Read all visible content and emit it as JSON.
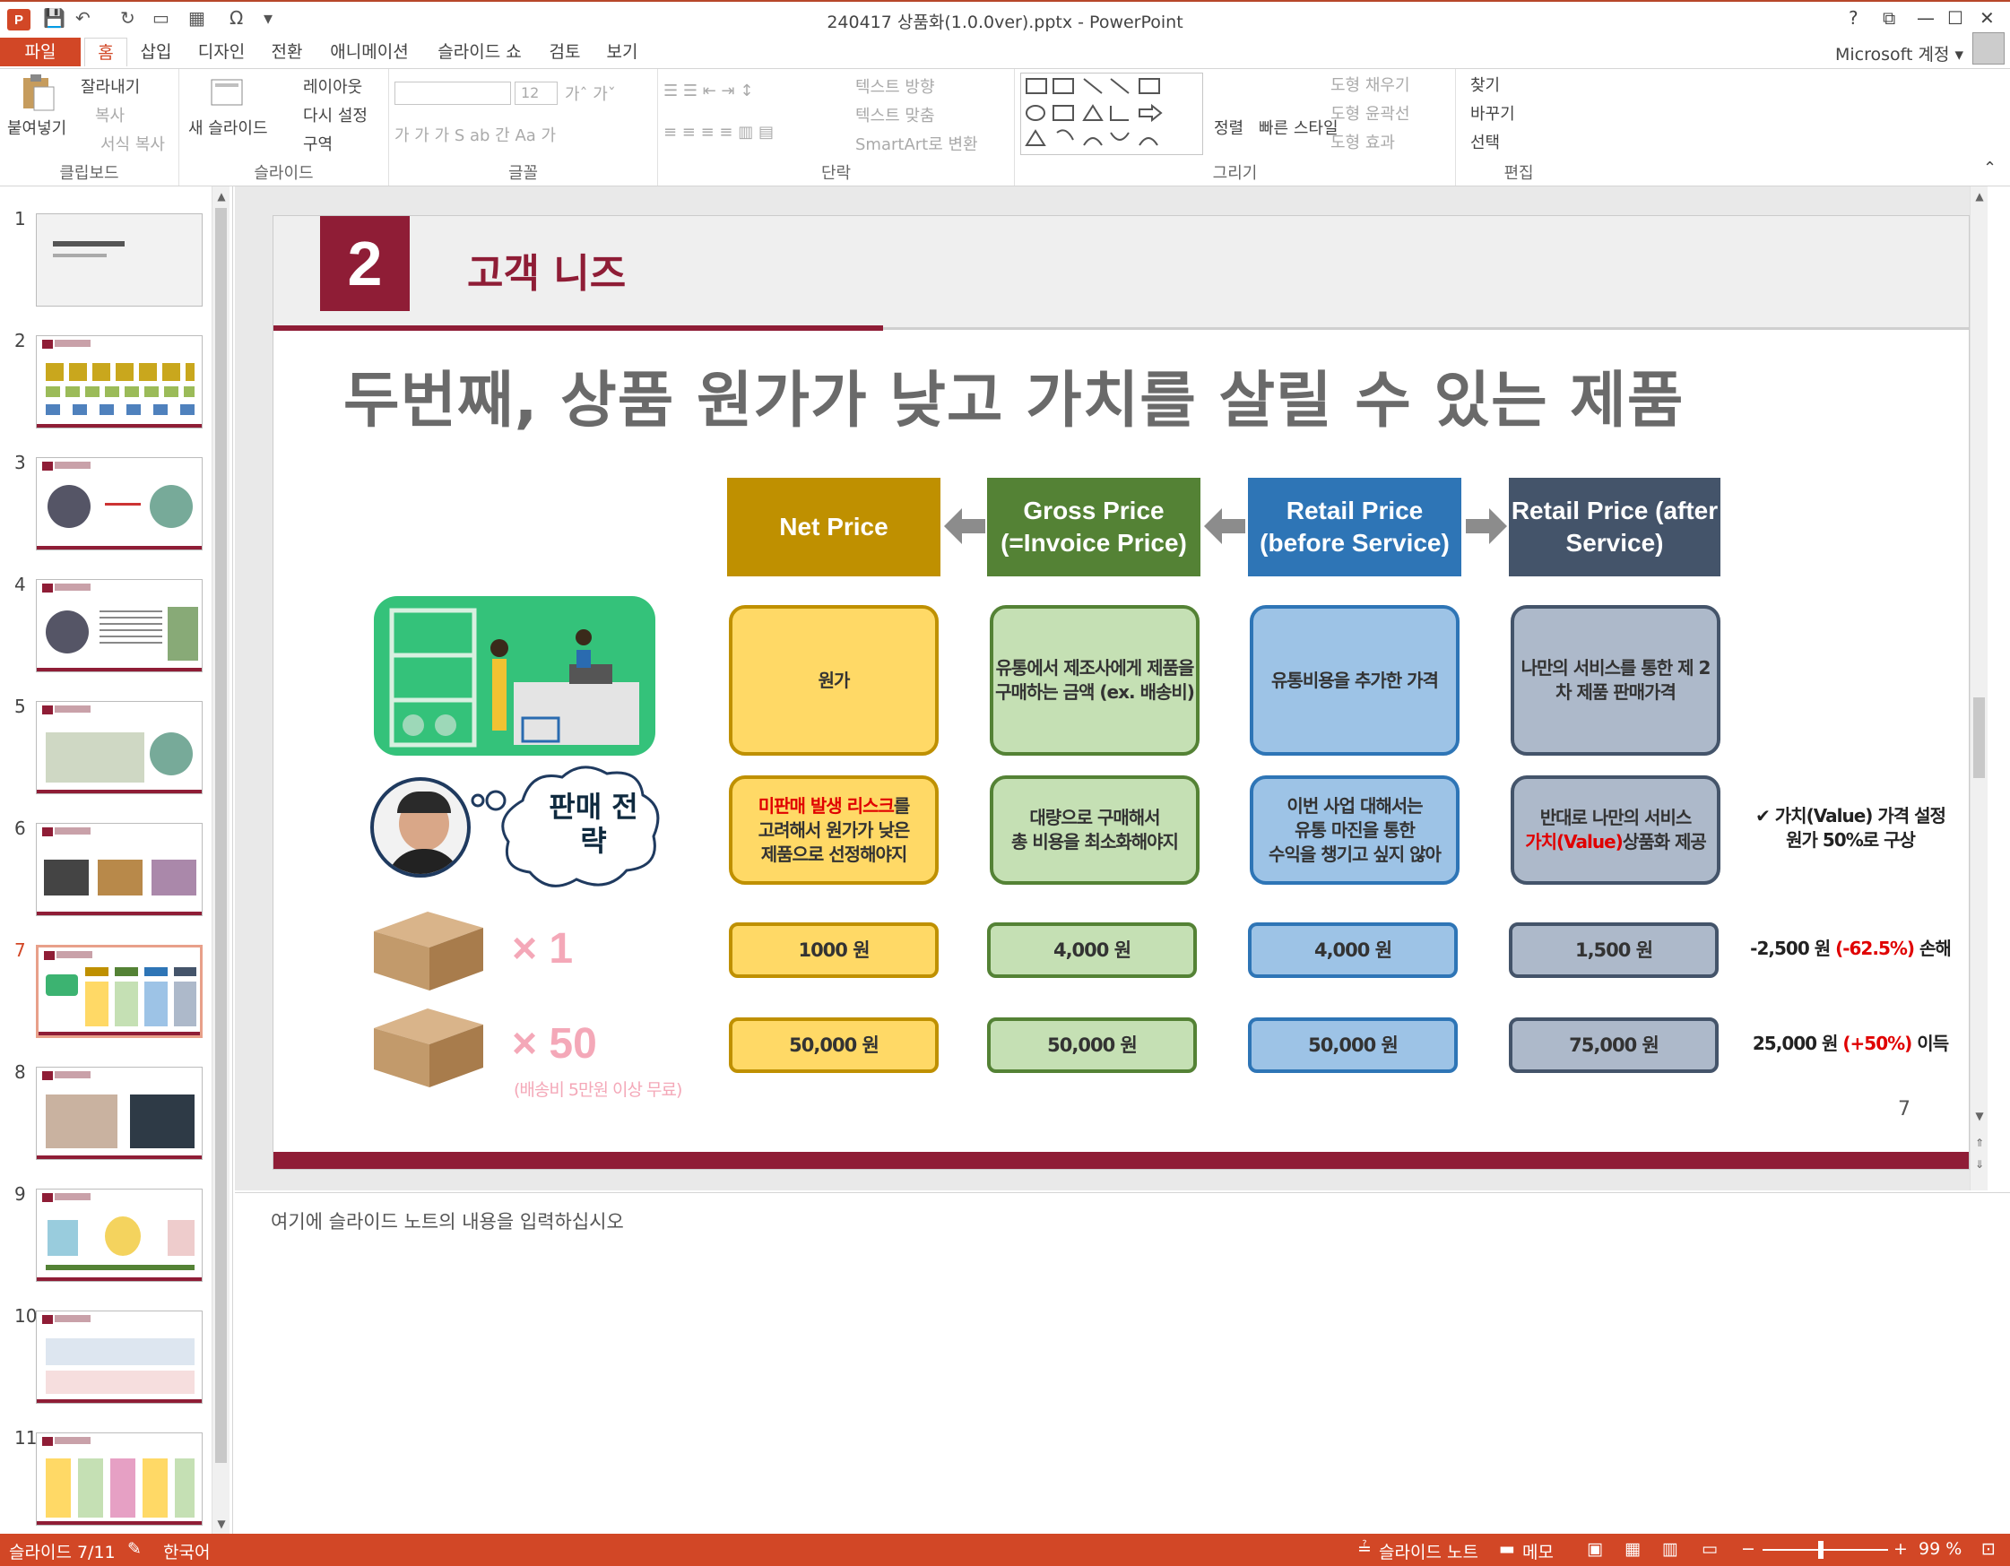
{
  "window": {
    "title": "240417 상품화(1.0.0ver).pptx - PowerPoint",
    "help": "?",
    "account": "Microsoft 계정 ▾"
  },
  "tabs": [
    "파일",
    "홈",
    "삽입",
    "디자인",
    "전환",
    "애니메이션",
    "슬라이드 쇼",
    "검토",
    "보기"
  ],
  "ribbon": {
    "clipboard": {
      "paste": "붙여넣기",
      "cut": "잘라내기",
      "copy": "복사",
      "format_painter": "서식 복사",
      "label": "클립보드"
    },
    "slides": {
      "new_slide": "새 슬라이드",
      "layout": "레이아웃",
      "reset": "다시 설정",
      "section": "구역",
      "label": "슬라이드"
    },
    "font": {
      "size": "12",
      "label": "글꼴"
    },
    "paragraph": {
      "text_direction": "텍스트 방향",
      "align_text": "텍스트 맞춤",
      "smartart": "SmartArt로 변환",
      "label": "단락"
    },
    "drawing": {
      "arrange": "정렬",
      "quick_styles": "빠른 스타일",
      "shape_fill": "도형 채우기",
      "shape_outline": "도형 윤곽선",
      "shape_effects": "도형 효과",
      "label": "그리기"
    },
    "editing": {
      "find": "찾기",
      "replace": "바꾸기",
      "select": "선택",
      "label": "편집"
    }
  },
  "slide": {
    "section_number": "2",
    "section_title": "고객 니즈",
    "main_title": "두번째, 상품 원가가 낮고 가치를 살릴 수 있는 제품",
    "page_number": "7",
    "colors": {
      "brand": "#8f1d36",
      "net": "#bf9000",
      "gross": "#548235",
      "retail_before": "#2e75b6",
      "retail_after": "#44546a"
    },
    "columns": [
      {
        "head": "Net Price"
      },
      {
        "head": "Gross Price (=Invoice Price)"
      },
      {
        "head": "Retail Price (before Service)"
      },
      {
        "head": "Retail Price (after Service)"
      }
    ],
    "row_definition": [
      "원가",
      "유통에서 제조사에게 제품을 구매하는 금액 (ex. 배송비)",
      "유통비용을 추가한 가격",
      "나만의 서비스를 통한 제 2차 제품 판매가격"
    ],
    "strategy_bubble": "판매 전략",
    "strategy": {
      "net_red": "미판매 발생 리스크",
      "net_rest1": "를",
      "net_rest2": "고려해서 원가가 낮은",
      "net_rest3": "제품으로 선정해야지",
      "gross1": "대량으로 구매해서",
      "gross2": "총 비용을 최소화해야지",
      "before1": "이번 사업 대해서는",
      "before2": "유통 마진을 통한",
      "before3": "수익을 챙기고 싶지 않아",
      "after1": "반대로 나만의 서비스",
      "after_red": "가치(Value)",
      "after2": "상품화 제공"
    },
    "strategy_note": {
      "line1": "✔ 가치(Value) 가격 설정",
      "line2": "원가 50%로 구상"
    },
    "qty1": "× 1",
    "qty50": "× 50",
    "shipping_note": "(배송비 5만원 이상 무료)",
    "row_x1": [
      "1000 원",
      "4,000 원",
      "4,000 원",
      "1,500 원"
    ],
    "row_x50": [
      "50,000 원",
      "50,000 원",
      "50,000 원",
      "75,000 원"
    ],
    "result_x1": {
      "amount": "-2,500 원",
      "pct": "(-62.5%)",
      "label": "손해"
    },
    "result_x50": {
      "amount": "25,000 원",
      "pct": "(+50%)",
      "label": "이득"
    }
  },
  "thumbnails": [
    "1",
    "2",
    "3",
    "4",
    "5",
    "6",
    "7",
    "8",
    "9",
    "10",
    "11"
  ],
  "notes_placeholder": "여기에 슬라이드 노트의 내용을 입력하십시오",
  "status": {
    "slide_info": "슬라이드 7/11",
    "language": "한국어",
    "notes": "슬라이드 노트",
    "comments": "메모",
    "zoom": "99 %"
  }
}
